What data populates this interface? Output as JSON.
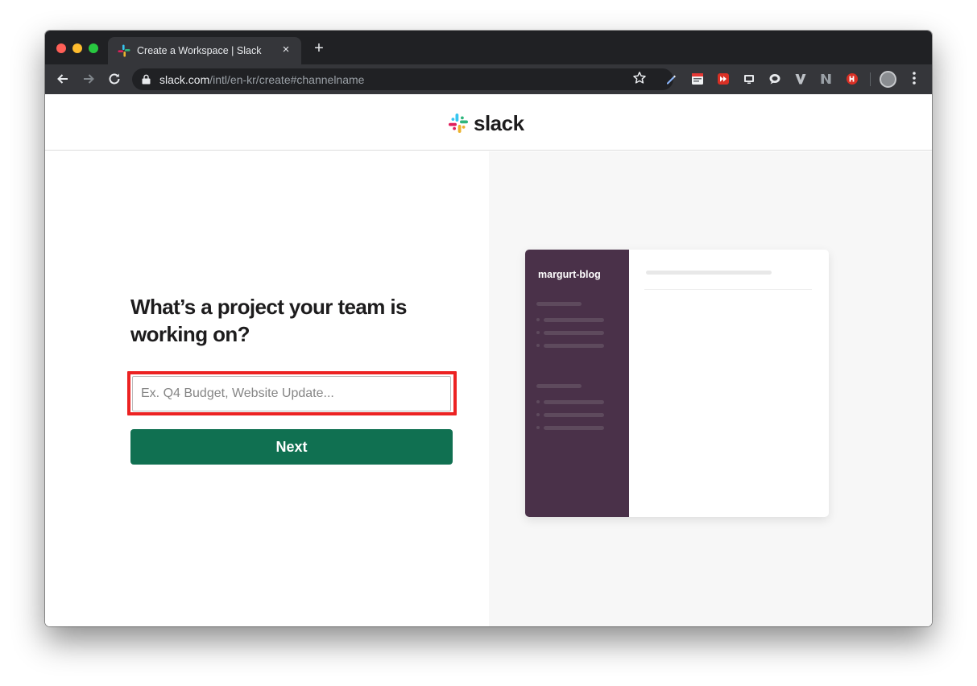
{
  "browser": {
    "tab_title": "Create a Workspace | Slack",
    "tab_close": "×",
    "new_tab": "+",
    "url_host": "slack.com",
    "url_path": "/intl/en-kr/create#channelname",
    "icons": {
      "back": "back-arrow-icon",
      "forward": "forward-arrow-icon",
      "reload": "reload-icon",
      "star": "bookmark-star-icon",
      "menu": "kebab-menu-icon"
    }
  },
  "header": {
    "logo_text": "slack"
  },
  "form": {
    "question": "What’s a project your team is working on?",
    "input_placeholder": "Ex. Q4 Budget, Website Update...",
    "input_value": "",
    "next_label": "Next"
  },
  "preview": {
    "workspace_name": "margurt-blog"
  },
  "colors": {
    "button_green": "#107051",
    "sidebar_aubergine": "#4a3149",
    "highlight_red": "#ec2222"
  }
}
